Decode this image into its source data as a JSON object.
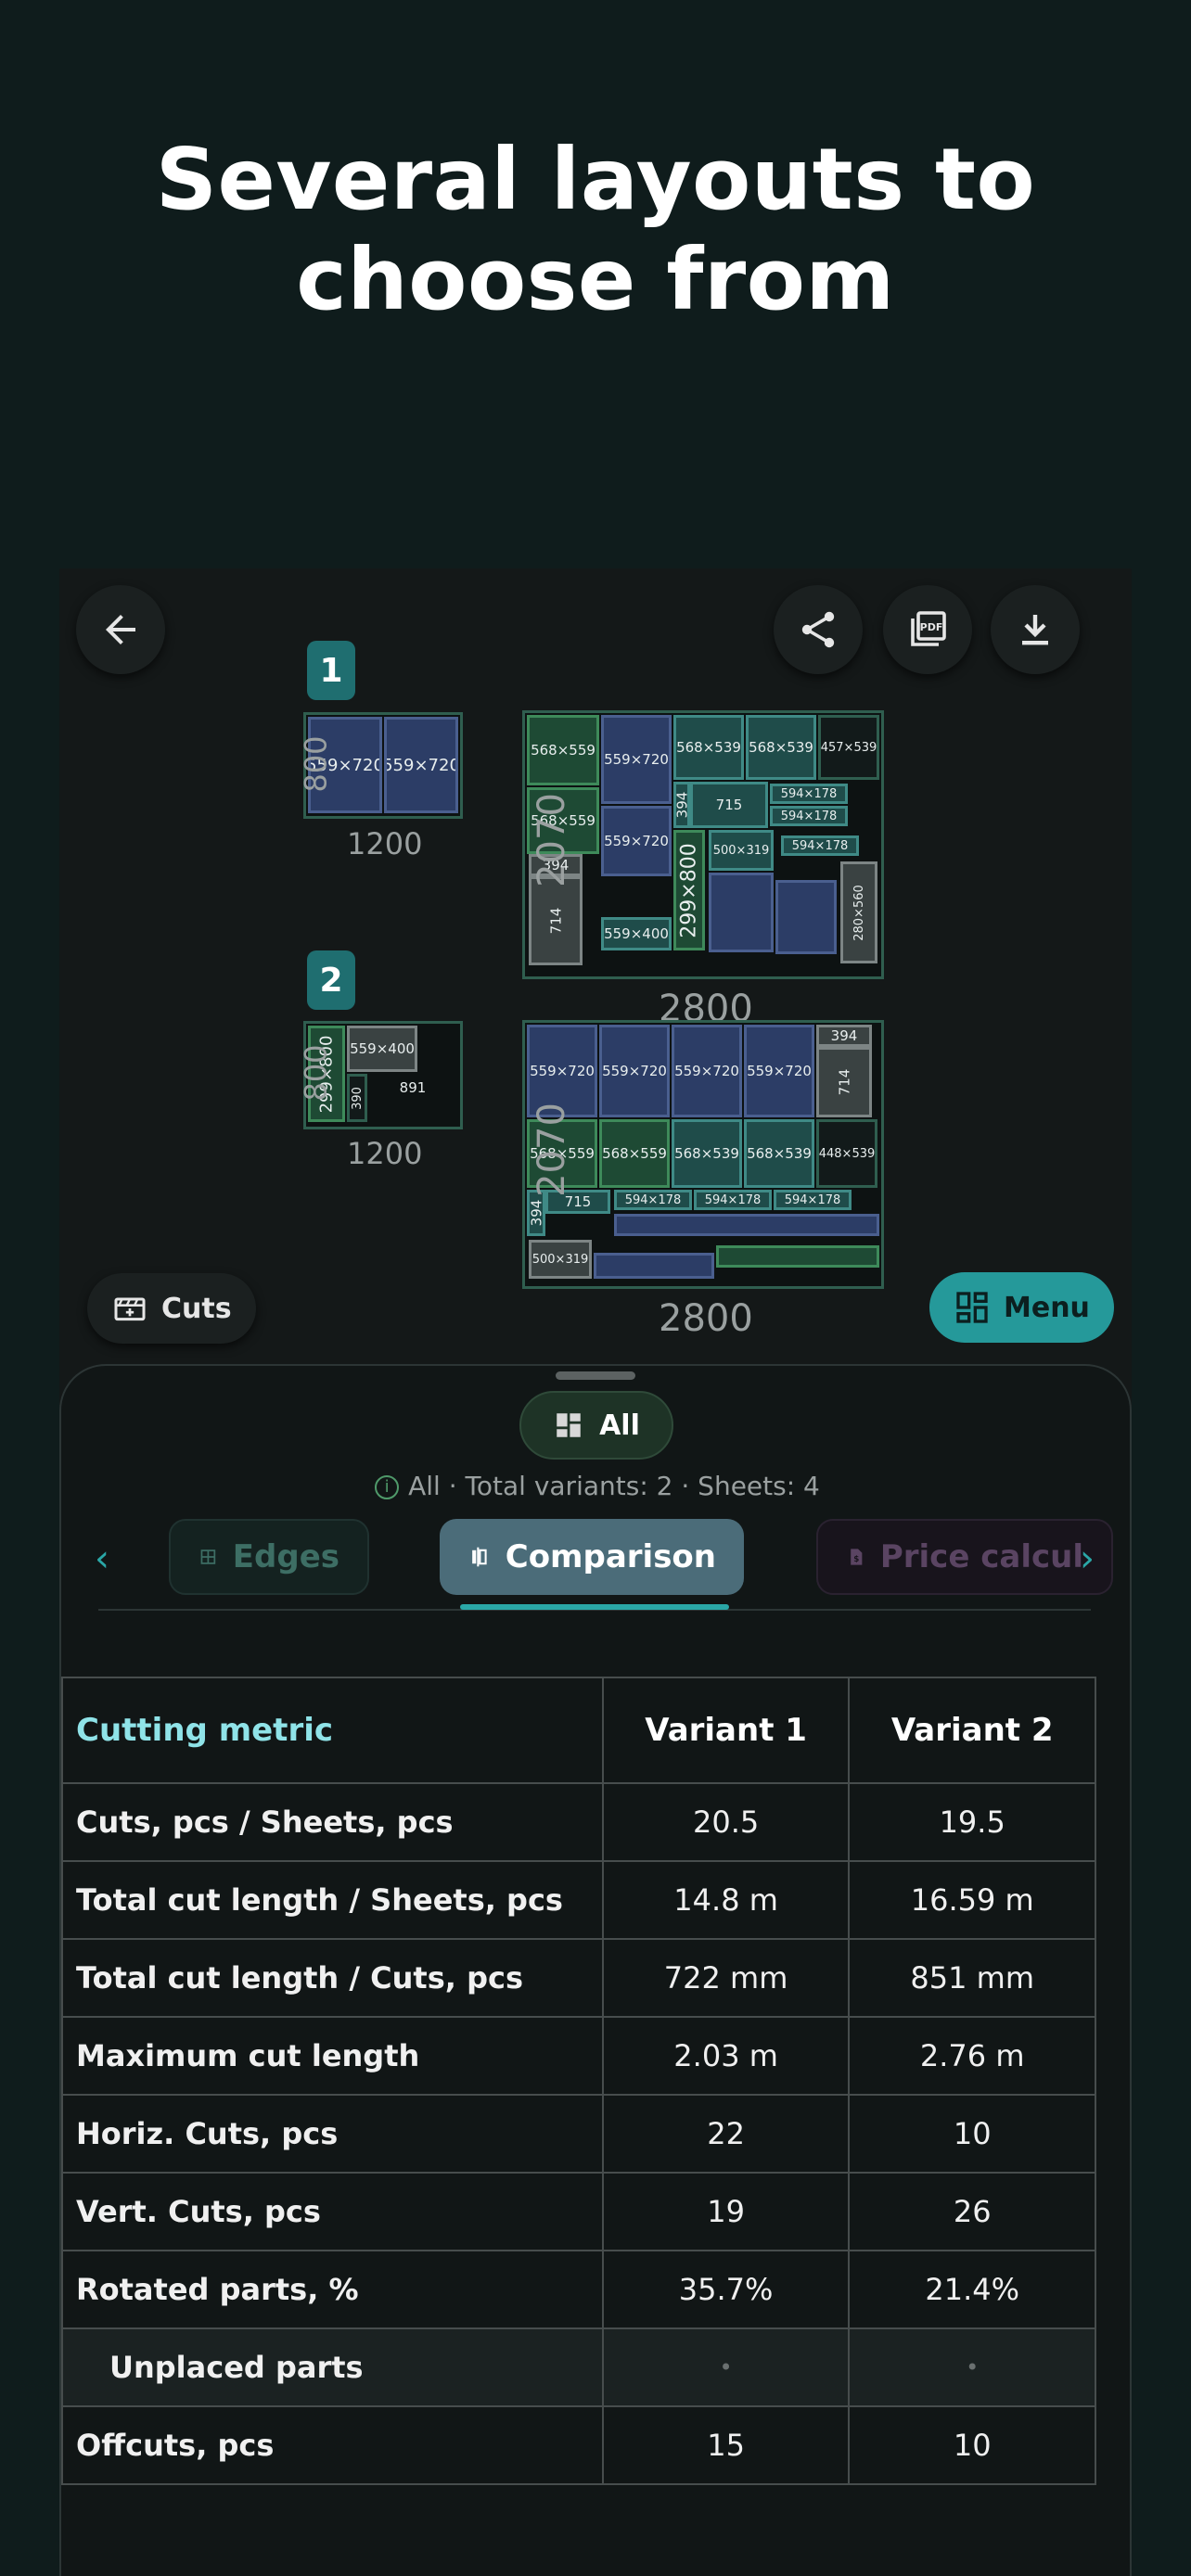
{
  "headline": {
    "line1": "Several layouts to",
    "line2": "choose from"
  },
  "toolbar": {
    "back_icon": "arrow-left-icon",
    "share_icon": "share-icon",
    "pdf_icon": "pdf-icon",
    "download_icon": "download-icon"
  },
  "layouts": [
    {
      "badge": "1",
      "small_sheet": {
        "width": "1200",
        "height": "800",
        "parts": [
          "559×720",
          "559×720"
        ]
      },
      "big_sheet": {
        "width": "2800",
        "height": "2070",
        "parts": [
          "568×559",
          "559×720",
          "568×539",
          "568×539",
          "457×539",
          "568×559",
          "715",
          "394",
          "594×178",
          "594×178",
          "594×178",
          "559×720",
          "299×800",
          "500×319",
          "394",
          "714",
          "559×400",
          "280×560"
        ]
      }
    },
    {
      "badge": "2",
      "small_sheet": {
        "width": "1200",
        "height": "800",
        "parts": [
          "299×800",
          "559×400",
          "390",
          "891"
        ]
      },
      "big_sheet": {
        "width": "2800",
        "height": "2070",
        "parts": [
          "559×720",
          "559×720",
          "559×720",
          "559×720",
          "394",
          "714",
          "568×559",
          "568×559",
          "568×539",
          "568×539",
          "448×539",
          "715",
          "394",
          "594×178",
          "594×178",
          "594×178",
          "500×319"
        ]
      }
    }
  ],
  "cuts_button": {
    "label": "Cuts",
    "icon": "cuts-icon"
  },
  "menu_button": {
    "label": "Menu",
    "icon": "grid-icon"
  },
  "panel": {
    "all_chip": "All",
    "summary": "All · Total variants: 2 · Sheets: 4",
    "tabs": [
      {
        "label": "Edges",
        "icon": "edges-icon"
      },
      {
        "label": "Comparison",
        "icon": "comparison-icon",
        "active": true
      },
      {
        "label": "Price calcul",
        "icon": "price-icon"
      }
    ]
  },
  "table": {
    "headers": [
      "Cutting metric",
      "Variant 1",
      "Variant 2"
    ],
    "rows": [
      [
        "Cuts, pcs / Sheets, pcs",
        "20.5",
        "19.5"
      ],
      [
        "Total cut length / Sheets, pcs",
        "14.8 m",
        "16.59 m"
      ],
      [
        "Total cut length / Cuts, pcs",
        "722 mm",
        "851 mm"
      ],
      [
        "Maximum cut length",
        "2.03 m",
        "2.76 m"
      ],
      [
        "Horiz. Cuts, pcs",
        "22",
        "10"
      ],
      [
        "Vert. Cuts, pcs",
        "19",
        "26"
      ],
      [
        "Rotated parts, %",
        "35.7%",
        "21.4%"
      ],
      [
        "Unplaced parts",
        "•",
        "•"
      ],
      [
        "Offcuts, pcs",
        "15",
        "10"
      ]
    ]
  }
}
